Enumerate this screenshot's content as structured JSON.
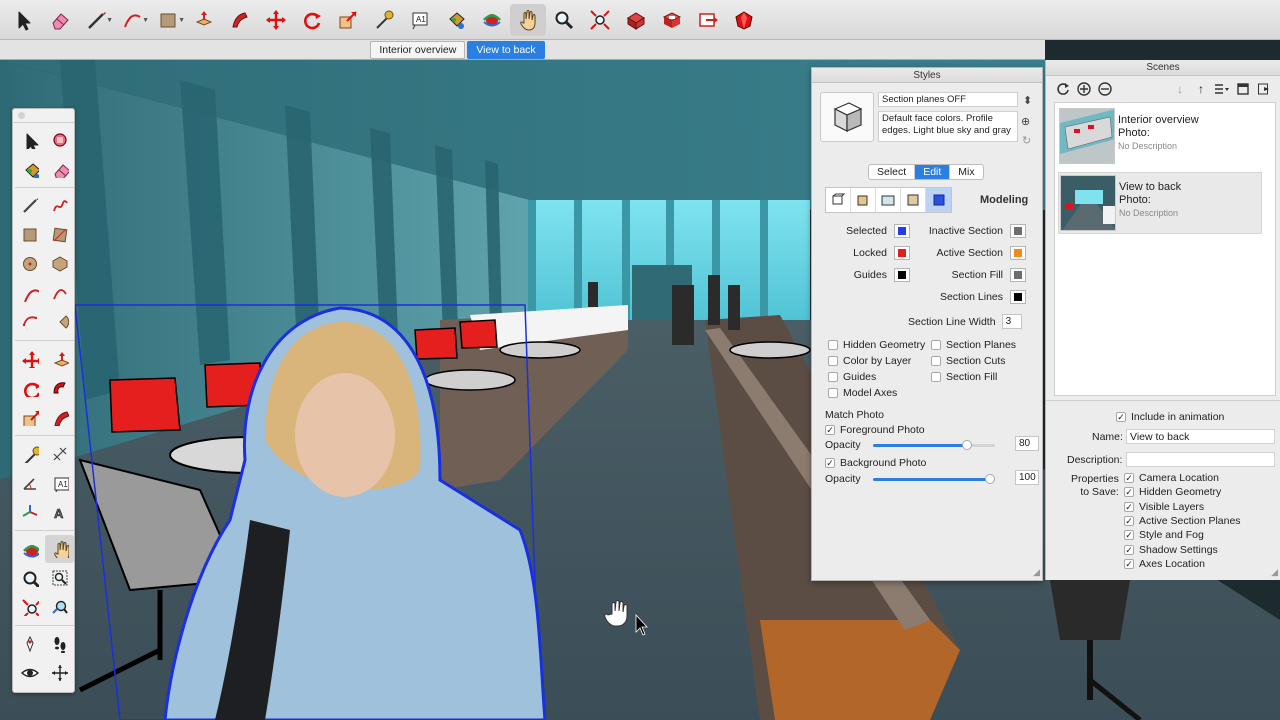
{
  "toolbar": {
    "items": [
      {
        "name": "select-tool-icon"
      },
      {
        "name": "eraser-tool-icon"
      },
      {
        "name": "pencil-line-tool-icon",
        "dropdown": true
      },
      {
        "name": "arc-tool-icon",
        "dropdown": true
      },
      {
        "name": "shapes-tool-icon",
        "dropdown": true
      },
      {
        "name": "push-pull-tool-icon"
      },
      {
        "name": "offset-tool-icon"
      },
      {
        "name": "move-tool-icon"
      },
      {
        "name": "rotate-tool-icon"
      },
      {
        "name": "scale-tool-icon"
      },
      {
        "name": "tape-measure-tool-icon"
      },
      {
        "name": "text-tool-icon"
      },
      {
        "name": "paint-bucket-tool-icon"
      },
      {
        "name": "orbit-tool-icon"
      },
      {
        "name": "pan-tool-icon",
        "active": true
      },
      {
        "name": "zoom-tool-icon"
      },
      {
        "name": "zoom-extents-tool-icon"
      },
      {
        "name": "3d-warehouse-icon"
      },
      {
        "name": "extension-warehouse-icon"
      },
      {
        "name": "layout-send-icon"
      },
      {
        "name": "extension-manager-icon"
      }
    ]
  },
  "scene_tabs": [
    {
      "label": "Interior overview",
      "active": false
    },
    {
      "label": "View to back",
      "active": true
    }
  ],
  "styles_panel": {
    "title": "Styles",
    "style_name": "Section planes OFF",
    "style_description": "Default face colors. Profile edges. Light blue sky and gray",
    "tabs": [
      {
        "label": "Select",
        "active": false
      },
      {
        "label": "Edit",
        "active": true
      },
      {
        "label": "Mix",
        "active": false
      }
    ],
    "mode_label": "Modeling",
    "colors_left": [
      {
        "label": "Selected",
        "color": "#1f3ee6"
      },
      {
        "label": "Locked",
        "color": "#e21e1e"
      },
      {
        "label": "Guides",
        "color": "#000000"
      }
    ],
    "colors_right": [
      {
        "label": "Inactive Section",
        "color": "#6e6e6e"
      },
      {
        "label": "Active Section",
        "color": "#f08a1e"
      },
      {
        "label": "Section Fill",
        "color": "#6e6e6e"
      },
      {
        "label": "Section Lines",
        "color": "#000000"
      }
    ],
    "section_line_width_label": "Section Line Width",
    "section_line_width": "3",
    "checkboxes_left": [
      {
        "label": "Hidden Geometry",
        "checked": false
      },
      {
        "label": "Color by Layer",
        "checked": false
      },
      {
        "label": "Guides",
        "checked": false
      },
      {
        "label": "Model Axes",
        "checked": false
      }
    ],
    "checkboxes_right": [
      {
        "label": "Section Planes",
        "checked": false
      },
      {
        "label": "Section Cuts",
        "checked": false
      },
      {
        "label": "Section Fill",
        "checked": false
      }
    ],
    "match_photo": {
      "heading": "Match Photo",
      "foreground_label": "Foreground Photo",
      "foreground_checked": true,
      "foreground_opacity_label": "Opacity",
      "foreground_opacity": 80,
      "background_label": "Background Photo",
      "background_checked": true,
      "background_opacity_label": "Opacity",
      "background_opacity": 100
    }
  },
  "scenes_panel": {
    "title": "Scenes",
    "scenes": [
      {
        "name": "Interior overview",
        "photo_label": "Photo:",
        "description": "No Description",
        "selected": false
      },
      {
        "name": "View to back",
        "photo_label": "Photo:",
        "description": "No Description",
        "selected": true
      }
    ],
    "include_in_animation_label": "Include in animation",
    "include_in_animation": true,
    "name_label": "Name:",
    "name_value": "View to back",
    "description_label": "Description:",
    "description_value": "",
    "properties_label_1": "Properties",
    "properties_label_2": "to Save:",
    "properties": [
      {
        "label": "Camera Location",
        "checked": true
      },
      {
        "label": "Hidden Geometry",
        "checked": true
      },
      {
        "label": "Visible Layers",
        "checked": true
      },
      {
        "label": "Active Section Planes",
        "checked": true
      },
      {
        "label": "Style and Fog",
        "checked": true
      },
      {
        "label": "Shadow Settings",
        "checked": true
      },
      {
        "label": "Axes Location",
        "checked": true
      }
    ]
  },
  "palette": {
    "tools": [
      "select-tool-icon",
      "component-tool-icon",
      "paint-bucket-tool-icon",
      "eraser-tool-icon",
      "line-tool-icon",
      "freehand-tool-icon",
      "rectangle-tool-icon",
      "rotated-rectangle-tool-icon",
      "circle-tool-icon",
      "polygon-tool-icon",
      "arc-tool-icon",
      "two-point-arc-tool-icon",
      "three-point-arc-tool-icon",
      "pie-tool-icon",
      "move-tool-icon",
      "push-pull-tool-icon",
      "rotate-tool-icon",
      "follow-me-tool-icon",
      "scale-tool-icon",
      "offset-tool-icon",
      "tape-measure-tool-icon",
      "dimension-tool-icon",
      "protractor-tool-icon",
      "text-tool-icon",
      "axes-tool-icon",
      "3d-text-tool-icon",
      "orbit-tool-icon",
      "pan-tool-icon",
      "zoom-tool-icon",
      "zoom-window-tool-icon",
      "zoom-extents-tool-icon",
      "previous-view-tool-icon",
      "position-camera-tool-icon",
      "walk-tool-icon",
      "look-around-tool-icon",
      "section-plane-tool-icon"
    ]
  }
}
